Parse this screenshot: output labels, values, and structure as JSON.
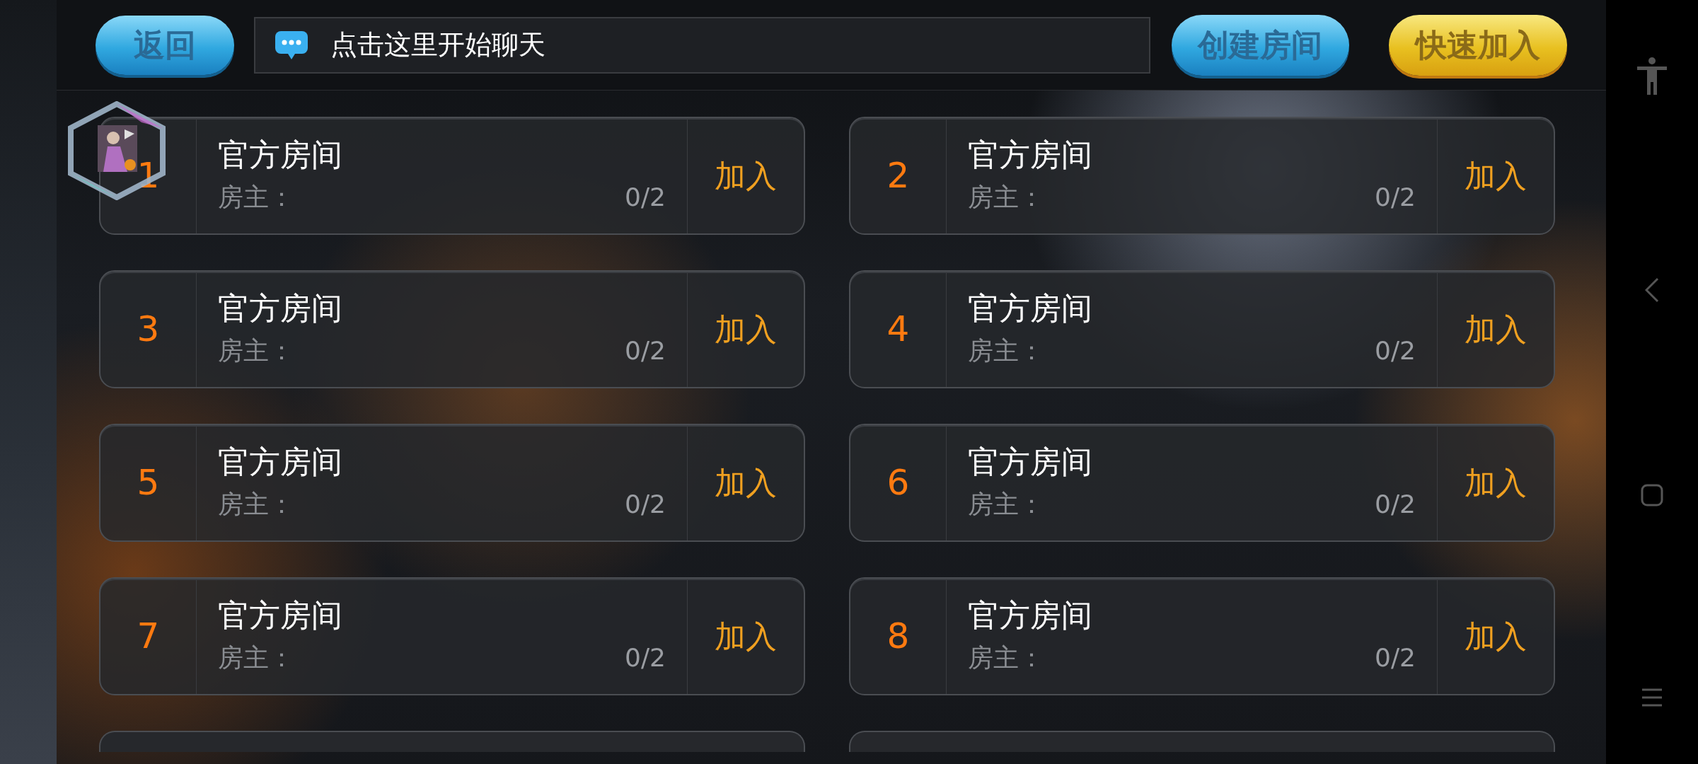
{
  "top_bar": {
    "back_button": "返回",
    "chat_field": {
      "placeholder": "点击这里开始聊天"
    },
    "create_room_button": "创建房间",
    "quick_join_button": "快速加入"
  },
  "rooms": [
    {
      "number": "1",
      "name": "官方房间",
      "owner_label": "房主：",
      "players": "0/2",
      "join_button": "加入",
      "has_avatar": true
    },
    {
      "number": "2",
      "name": "官方房间",
      "owner_label": "房主：",
      "players": "0/2",
      "join_button": "加入",
      "has_avatar": false
    },
    {
      "number": "3",
      "name": "官方房间",
      "owner_label": "房主：",
      "players": "0/2",
      "join_button": "加入",
      "has_avatar": false
    },
    {
      "number": "4",
      "name": "官方房间",
      "owner_label": "房主：",
      "players": "0/2",
      "join_button": "加入",
      "has_avatar": false
    },
    {
      "number": "5",
      "name": "官方房间",
      "owner_label": "房主：",
      "players": "0/2",
      "join_button": "加入",
      "has_avatar": false
    },
    {
      "number": "6",
      "name": "官方房间",
      "owner_label": "房主：",
      "players": "0/2",
      "join_button": "加入",
      "has_avatar": false
    },
    {
      "number": "7",
      "name": "官方房间",
      "owner_label": "房主：",
      "players": "0/2",
      "join_button": "加入",
      "has_avatar": false
    },
    {
      "number": "8",
      "name": "官方房间",
      "owner_label": "房主：",
      "players": "0/2",
      "join_button": "加入",
      "has_avatar": false
    }
  ]
}
